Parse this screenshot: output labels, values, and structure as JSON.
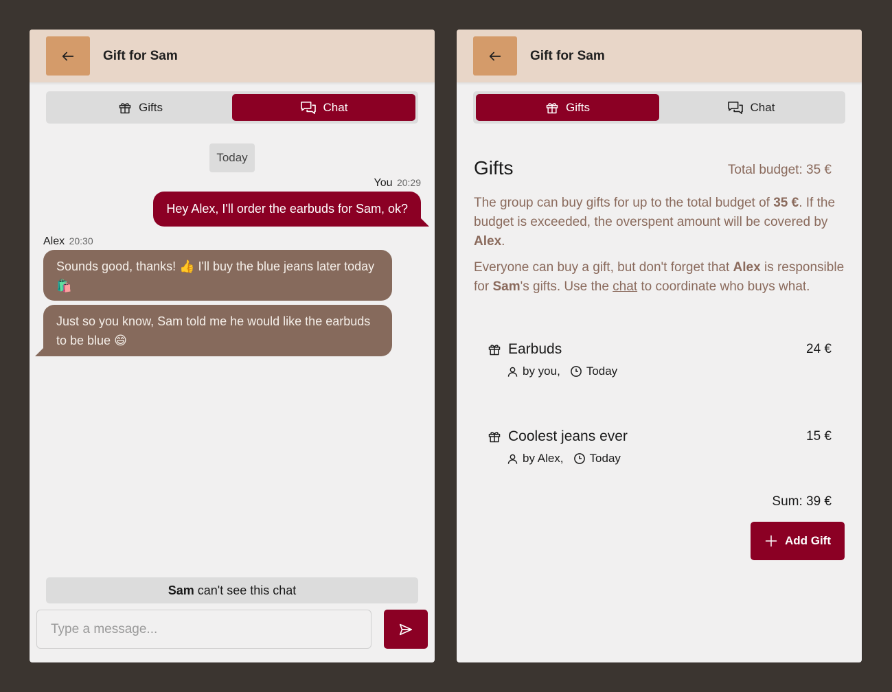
{
  "chat_panel": {
    "header": {
      "title": "Gift for Sam"
    },
    "tabs": [
      {
        "label": "Gifts",
        "active": false
      },
      {
        "label": "Chat",
        "active": true
      }
    ],
    "date_chip": "Today",
    "messages": [
      {
        "sender": "You",
        "time": "20:29",
        "text": "Hey Alex, I'll order the earbuds for Sam, ok?",
        "mine": true
      },
      {
        "sender": "Alex",
        "time": "20:30",
        "text": "Sounds good, thanks! 👍 I'll buy the blue jeans later today 🛍️",
        "mine": false
      },
      {
        "sender": "Alex",
        "time": "",
        "text": "Just so you know, Sam told me he would like the earbuds to be blue 😄",
        "mine": false
      }
    ],
    "privacy_note": {
      "name": "Sam",
      "text": "can't see this chat"
    },
    "input": {
      "placeholder": "Type a message...",
      "value": ""
    }
  },
  "gifts_panel": {
    "header": {
      "title": "Gift for Sam"
    },
    "tabs": [
      {
        "label": "Gifts",
        "active": true
      },
      {
        "label": "Chat",
        "active": false
      }
    ],
    "heading": "Gifts",
    "total_budget": "Total budget: 35 €",
    "info": {
      "p1_a": "The group can buy gifts for up to the total budget of ",
      "p1_amount": "35 €",
      "p1_b": ". If the budget is exceeded, the overspent amount will be covered by ",
      "p1_name": "Alex",
      "p1_c": ".",
      "p2_a": "Everyone can buy a gift, but don't forget that ",
      "p2_name1": "Alex",
      "p2_b": " is responsible for ",
      "p2_name2": "Sam",
      "p2_c": "'s gifts. Use the ",
      "p2_link": "chat",
      "p2_d": " to coordinate who buys what."
    },
    "gifts": [
      {
        "name": "Earbuds",
        "price": "24 €",
        "by": "by you,",
        "when": "Today"
      },
      {
        "name": "Coolest jeans ever",
        "price": "15 €",
        "by": "by Alex,",
        "when": "Today"
      }
    ],
    "sum": "Sum: 39 €",
    "add_button": "Add Gift"
  },
  "colors": {
    "background": "#3b3530",
    "header": "#e8d6c8",
    "back_button": "#d49b6a",
    "accent": "#8b0024",
    "other_bubble": "#866a5c",
    "muted_text": "#8a6a5c"
  },
  "icons": [
    "arrow-left-icon",
    "gift-icon",
    "chat-bubbles-icon",
    "send-icon",
    "user-icon",
    "clock-icon",
    "plus-icon"
  ]
}
